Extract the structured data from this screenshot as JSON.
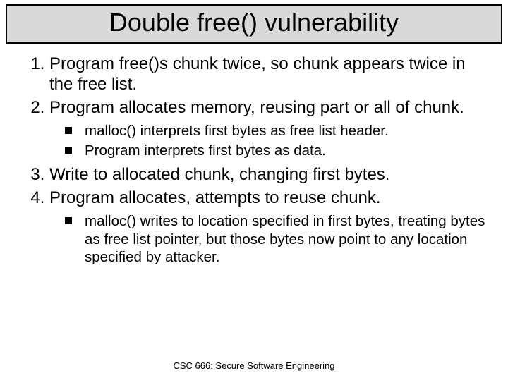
{
  "title": "Double free() vulnerability",
  "items": {
    "i1": "Program free()s chunk twice, so chunk appears twice in the free list.",
    "i2": "Program allocates memory, reusing part or all of chunk.",
    "i2sub": {
      "a": "malloc() interprets first bytes as free list header.",
      "b": "Program interprets first bytes as data."
    },
    "i3": "Write to allocated chunk, changing first bytes.",
    "i4": "Program allocates, attempts to reuse chunk.",
    "i4sub": {
      "a": "malloc() writes to location specified in first bytes, treating bytes as free list pointer, but those bytes now point to any location specified by attacker."
    }
  },
  "footer": "CSC 666: Secure Software Engineering"
}
